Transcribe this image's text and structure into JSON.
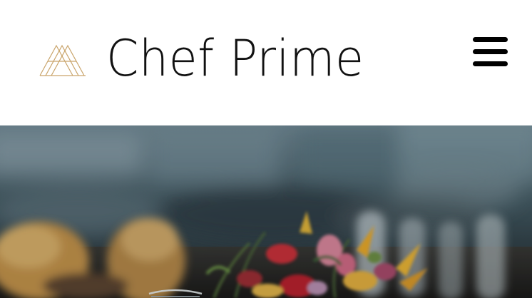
{
  "header": {
    "brand_name": "Chef Prime",
    "logo_icon": "triangle-mountains-icon",
    "menu_icon": "hamburger-menu-icon"
  },
  "hero": {
    "image_subject": "restaurant-table-flowers-photo"
  },
  "colors": {
    "header_bg": "#ffffff",
    "brand_text": "#111111",
    "logo_gold": "#c9a46a",
    "menu_icon": "#000000",
    "hero_base": "#2b3940"
  }
}
